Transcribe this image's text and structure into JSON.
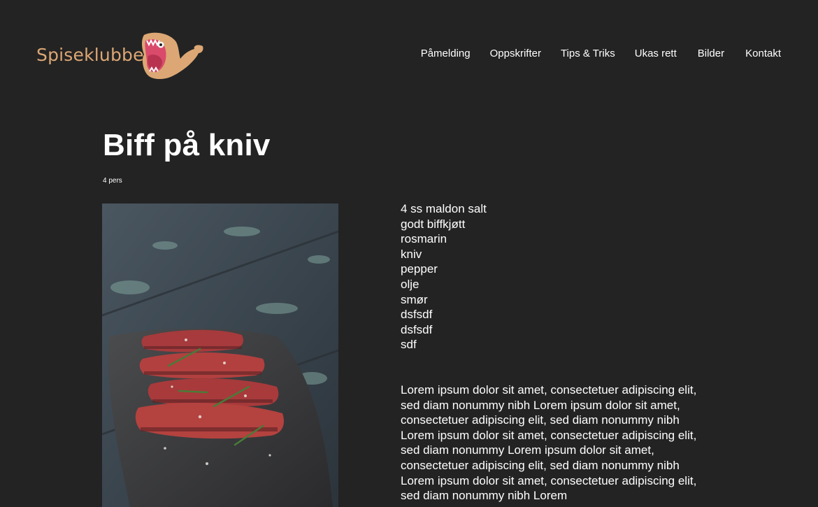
{
  "header": {
    "logo_text": "Spiseklubben",
    "nav": [
      {
        "label": "Påmelding"
      },
      {
        "label": "Oppskrifter"
      },
      {
        "label": "Tips & Triks"
      },
      {
        "label": "Ukas rett"
      },
      {
        "label": "Bilder"
      },
      {
        "label": "Kontakt"
      }
    ]
  },
  "recipe": {
    "title": "Biff på kniv",
    "servings": "4 pers",
    "ingredients": [
      "4 ss maldon salt",
      "godt biffkjøtt",
      "rosmarin",
      "kniv",
      "pepper",
      "olje",
      "smør",
      "dsfsdf",
      "dsfsdf",
      "sdf"
    ],
    "description": "Lorem ipsum dolor sit amet, consectetuer adipiscing elit, sed diam nonummy nibh Lorem ipsum dolor sit amet, consectetuer adipiscing elit, sed diam nonum­my nibh Lorem ipsum dolor sit amet, consectetuer adipiscing elit, sed diam nonummy Lorem ipsum dolor sit amet, consectetuer adipiscing elit, sed diam nonummy nibh Lorem ipsum dolor sit amet, consec­tetuer adipiscing elit, sed diam nonummy nibh Lorem"
  },
  "colors": {
    "background": "#232323",
    "brand": "#dca774",
    "text": "#ffffff"
  },
  "icons": {
    "logo_mascot": "whale-icon"
  }
}
